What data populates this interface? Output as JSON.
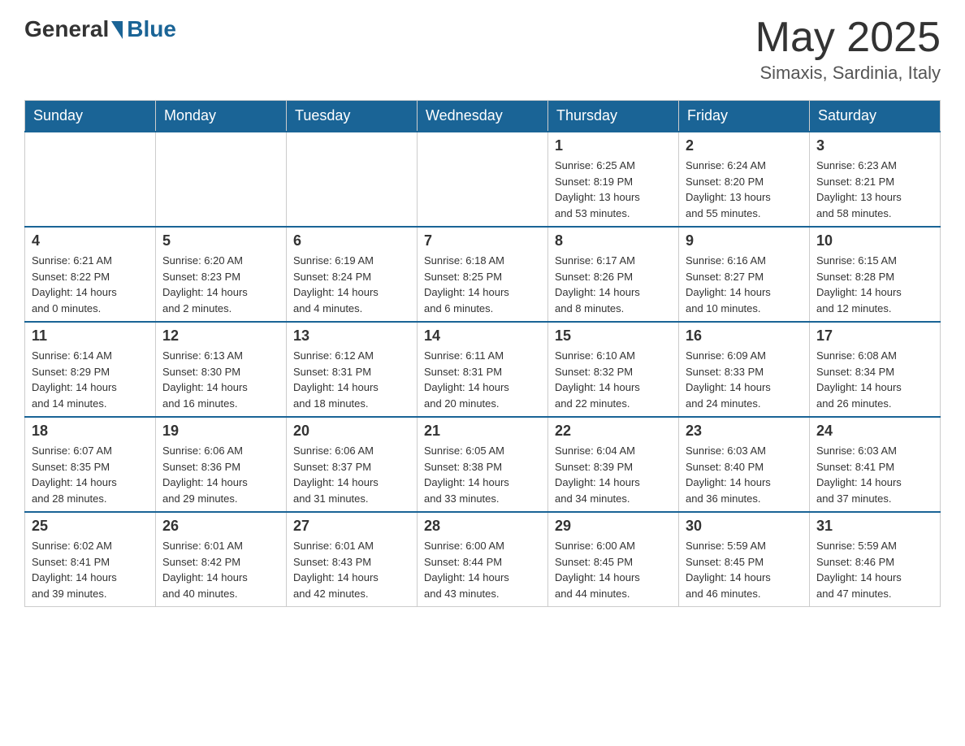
{
  "header": {
    "logo_general": "General",
    "logo_blue": "Blue",
    "month_year": "May 2025",
    "location": "Simaxis, Sardinia, Italy"
  },
  "days_of_week": [
    "Sunday",
    "Monday",
    "Tuesday",
    "Wednesday",
    "Thursday",
    "Friday",
    "Saturday"
  ],
  "weeks": [
    [
      {
        "day": "",
        "info": ""
      },
      {
        "day": "",
        "info": ""
      },
      {
        "day": "",
        "info": ""
      },
      {
        "day": "",
        "info": ""
      },
      {
        "day": "1",
        "info": "Sunrise: 6:25 AM\nSunset: 8:19 PM\nDaylight: 13 hours\nand 53 minutes."
      },
      {
        "day": "2",
        "info": "Sunrise: 6:24 AM\nSunset: 8:20 PM\nDaylight: 13 hours\nand 55 minutes."
      },
      {
        "day": "3",
        "info": "Sunrise: 6:23 AM\nSunset: 8:21 PM\nDaylight: 13 hours\nand 58 minutes."
      }
    ],
    [
      {
        "day": "4",
        "info": "Sunrise: 6:21 AM\nSunset: 8:22 PM\nDaylight: 14 hours\nand 0 minutes."
      },
      {
        "day": "5",
        "info": "Sunrise: 6:20 AM\nSunset: 8:23 PM\nDaylight: 14 hours\nand 2 minutes."
      },
      {
        "day": "6",
        "info": "Sunrise: 6:19 AM\nSunset: 8:24 PM\nDaylight: 14 hours\nand 4 minutes."
      },
      {
        "day": "7",
        "info": "Sunrise: 6:18 AM\nSunset: 8:25 PM\nDaylight: 14 hours\nand 6 minutes."
      },
      {
        "day": "8",
        "info": "Sunrise: 6:17 AM\nSunset: 8:26 PM\nDaylight: 14 hours\nand 8 minutes."
      },
      {
        "day": "9",
        "info": "Sunrise: 6:16 AM\nSunset: 8:27 PM\nDaylight: 14 hours\nand 10 minutes."
      },
      {
        "day": "10",
        "info": "Sunrise: 6:15 AM\nSunset: 8:28 PM\nDaylight: 14 hours\nand 12 minutes."
      }
    ],
    [
      {
        "day": "11",
        "info": "Sunrise: 6:14 AM\nSunset: 8:29 PM\nDaylight: 14 hours\nand 14 minutes."
      },
      {
        "day": "12",
        "info": "Sunrise: 6:13 AM\nSunset: 8:30 PM\nDaylight: 14 hours\nand 16 minutes."
      },
      {
        "day": "13",
        "info": "Sunrise: 6:12 AM\nSunset: 8:31 PM\nDaylight: 14 hours\nand 18 minutes."
      },
      {
        "day": "14",
        "info": "Sunrise: 6:11 AM\nSunset: 8:31 PM\nDaylight: 14 hours\nand 20 minutes."
      },
      {
        "day": "15",
        "info": "Sunrise: 6:10 AM\nSunset: 8:32 PM\nDaylight: 14 hours\nand 22 minutes."
      },
      {
        "day": "16",
        "info": "Sunrise: 6:09 AM\nSunset: 8:33 PM\nDaylight: 14 hours\nand 24 minutes."
      },
      {
        "day": "17",
        "info": "Sunrise: 6:08 AM\nSunset: 8:34 PM\nDaylight: 14 hours\nand 26 minutes."
      }
    ],
    [
      {
        "day": "18",
        "info": "Sunrise: 6:07 AM\nSunset: 8:35 PM\nDaylight: 14 hours\nand 28 minutes."
      },
      {
        "day": "19",
        "info": "Sunrise: 6:06 AM\nSunset: 8:36 PM\nDaylight: 14 hours\nand 29 minutes."
      },
      {
        "day": "20",
        "info": "Sunrise: 6:06 AM\nSunset: 8:37 PM\nDaylight: 14 hours\nand 31 minutes."
      },
      {
        "day": "21",
        "info": "Sunrise: 6:05 AM\nSunset: 8:38 PM\nDaylight: 14 hours\nand 33 minutes."
      },
      {
        "day": "22",
        "info": "Sunrise: 6:04 AM\nSunset: 8:39 PM\nDaylight: 14 hours\nand 34 minutes."
      },
      {
        "day": "23",
        "info": "Sunrise: 6:03 AM\nSunset: 8:40 PM\nDaylight: 14 hours\nand 36 minutes."
      },
      {
        "day": "24",
        "info": "Sunrise: 6:03 AM\nSunset: 8:41 PM\nDaylight: 14 hours\nand 37 minutes."
      }
    ],
    [
      {
        "day": "25",
        "info": "Sunrise: 6:02 AM\nSunset: 8:41 PM\nDaylight: 14 hours\nand 39 minutes."
      },
      {
        "day": "26",
        "info": "Sunrise: 6:01 AM\nSunset: 8:42 PM\nDaylight: 14 hours\nand 40 minutes."
      },
      {
        "day": "27",
        "info": "Sunrise: 6:01 AM\nSunset: 8:43 PM\nDaylight: 14 hours\nand 42 minutes."
      },
      {
        "day": "28",
        "info": "Sunrise: 6:00 AM\nSunset: 8:44 PM\nDaylight: 14 hours\nand 43 minutes."
      },
      {
        "day": "29",
        "info": "Sunrise: 6:00 AM\nSunset: 8:45 PM\nDaylight: 14 hours\nand 44 minutes."
      },
      {
        "day": "30",
        "info": "Sunrise: 5:59 AM\nSunset: 8:45 PM\nDaylight: 14 hours\nand 46 minutes."
      },
      {
        "day": "31",
        "info": "Sunrise: 5:59 AM\nSunset: 8:46 PM\nDaylight: 14 hours\nand 47 minutes."
      }
    ]
  ]
}
